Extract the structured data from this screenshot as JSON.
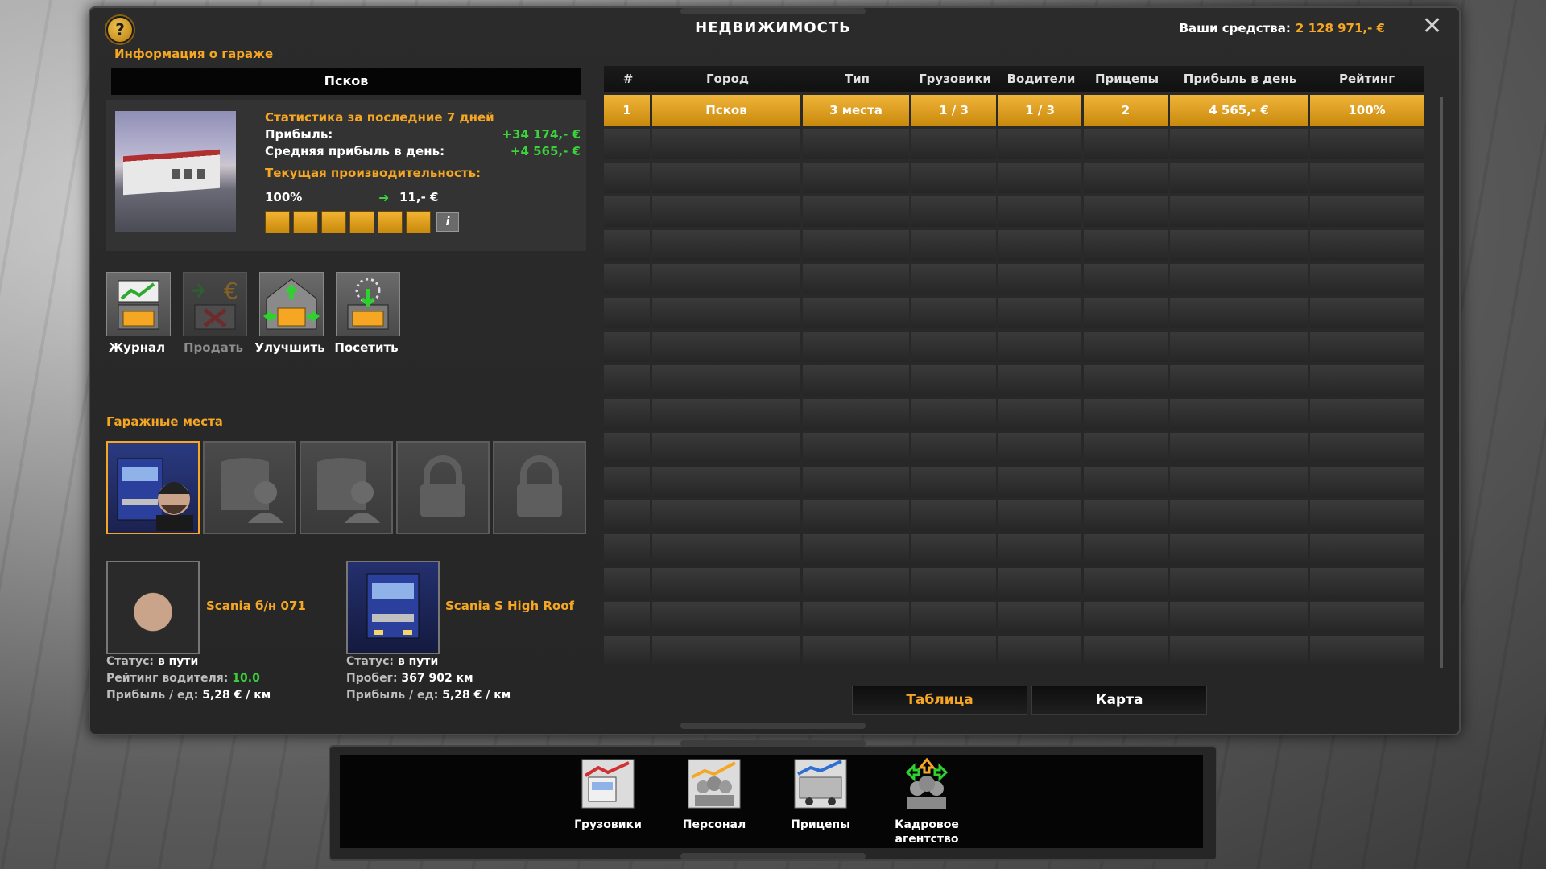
{
  "header": {
    "title": "НЕДВИЖИМОСТЬ",
    "funds_label": "Ваши средства:",
    "funds_value": "2 128 971,- €",
    "help": "?",
    "close": "✕"
  },
  "garage_info": {
    "section_label": "Информация о гараже",
    "city": "Псков",
    "stats_title": "Статистика за последние 7 дней",
    "profit_label": "Прибыль:",
    "profit_value": "+34 174,- €",
    "avg_profit_label": "Средняя прибыль в день:",
    "avg_profit_value": "+4 565,- €",
    "performance_label": "Текущая производительность:",
    "performance_pct": "100%",
    "performance_value": "11,- €",
    "performance_bars_filled": 6,
    "performance_bars_total": 6,
    "info_button": "i"
  },
  "actions": [
    {
      "label": "Журнал",
      "icon": "journal-icon",
      "enabled": true
    },
    {
      "label": "Продать",
      "icon": "sell-icon",
      "enabled": false
    },
    {
      "label": "Улучшить",
      "icon": "upgrade-icon",
      "enabled": true
    },
    {
      "label": "Посетить",
      "icon": "visit-icon",
      "enabled": true
    }
  ],
  "slots": {
    "section_label": "Гаражные места",
    "items": [
      {
        "state": "occupied"
      },
      {
        "state": "empty"
      },
      {
        "state": "empty"
      },
      {
        "state": "locked"
      },
      {
        "state": "locked"
      }
    ]
  },
  "driver": {
    "name": "Scania б/н 071",
    "status_label": "Статус:",
    "status_value": "в пути",
    "rating_label": "Рейтинг водителя:",
    "rating_value": "10.0",
    "profit_label": "Прибыль / ед:",
    "profit_value": "5,28 € / км"
  },
  "truck": {
    "name": "Scania S High Roof",
    "status_label": "Статус:",
    "status_value": "в пути",
    "mileage_label": "Пробег:",
    "mileage_value": "367 902 км",
    "profit_label": "Прибыль / ед:",
    "profit_value": "5,28 € / км"
  },
  "table": {
    "headers": [
      "#",
      "Город",
      "Тип",
      "Грузовики",
      "Водители",
      "Прицепы",
      "Прибыль в день",
      "Рейтинг"
    ],
    "rows": [
      [
        "1",
        "Псков",
        "3 места",
        "1 / 3",
        "1 / 3",
        "2",
        "4 565,- €",
        "100%"
      ]
    ],
    "empty_rows": 16
  },
  "view_tabs": [
    {
      "label": "Таблица",
      "active": true
    },
    {
      "label": "Карта",
      "active": false
    }
  ],
  "dock": [
    {
      "label": "Грузовики",
      "icon": "trucks-icon"
    },
    {
      "label": "Персонал",
      "icon": "staff-icon"
    },
    {
      "label": "Прицепы",
      "icon": "trailers-icon"
    },
    {
      "label": "Кадровое агентство",
      "icon": "recruitment-agency-icon"
    }
  ],
  "colors": {
    "accent": "#f5a623",
    "positive": "#3bd13b",
    "panel": "#2b2b2b"
  }
}
